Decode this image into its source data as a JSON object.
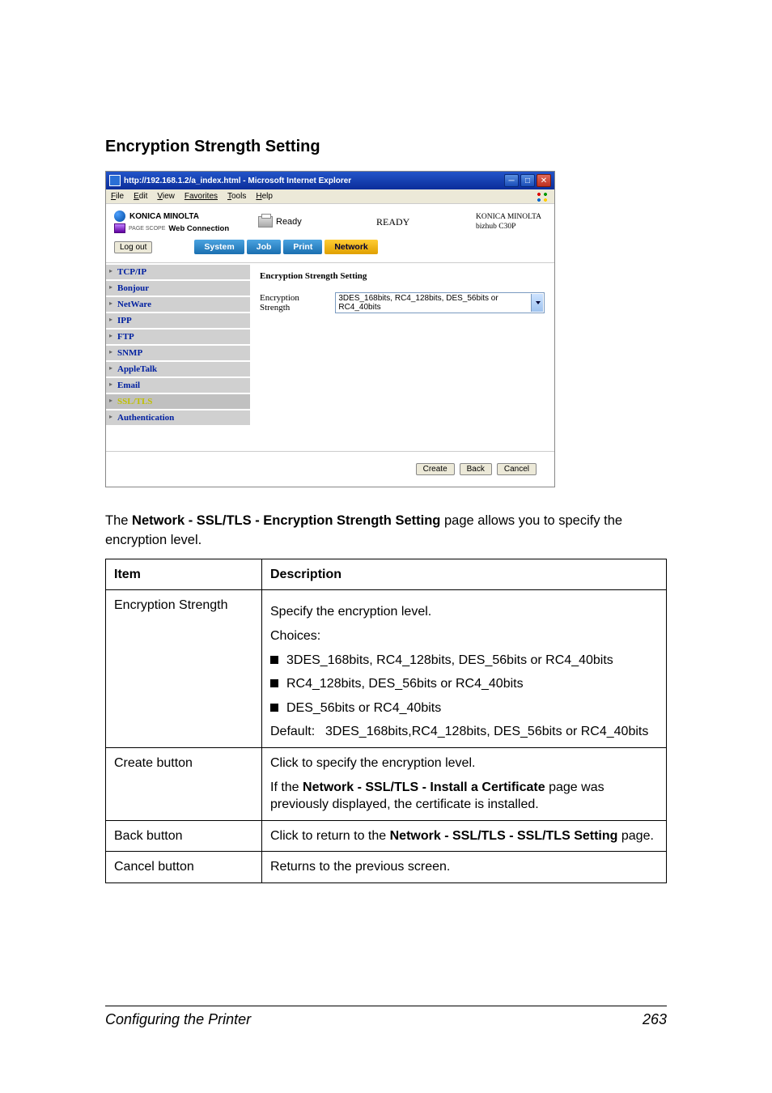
{
  "heading": "Encryption Strength Setting",
  "screenshot": {
    "window_title": "http://192.168.1.2/a_index.html - Microsoft Internet Explorer",
    "menu": [
      "File",
      "Edit",
      "View",
      "Favorites",
      "Tools",
      "Help"
    ],
    "brand": "KONICA MINOLTA",
    "pagescope_label": "PAGE SCOPE",
    "pagescope_text": "Web Connection",
    "ready_small": "Ready",
    "ready_big": "READY",
    "device_line1": "KONICA MINOLTA",
    "device_line2": "bizhub C30P",
    "logout": "Log out",
    "tabs": [
      {
        "label": "System",
        "active": false
      },
      {
        "label": "Job",
        "active": false
      },
      {
        "label": "Print",
        "active": false
      },
      {
        "label": "Network",
        "active": true
      }
    ],
    "sidebar": [
      {
        "label": "TCP/IP",
        "active": false
      },
      {
        "label": "Bonjour",
        "active": false
      },
      {
        "label": "NetWare",
        "active": false
      },
      {
        "label": "IPP",
        "active": false
      },
      {
        "label": "FTP",
        "active": false
      },
      {
        "label": "SNMP",
        "active": false
      },
      {
        "label": "AppleTalk",
        "active": false
      },
      {
        "label": "Email",
        "active": false
      },
      {
        "label": "SSL/TLS",
        "active": true
      },
      {
        "label": "Authentication",
        "active": false
      }
    ],
    "panel_title": "Encryption Strength Setting",
    "field_label": "Encryption Strength",
    "select_value": "3DES_168bits, RC4_128bits, DES_56bits or RC4_40bits",
    "footer_buttons": [
      "Create",
      "Back",
      "Cancel"
    ]
  },
  "intro_para_pre": "The ",
  "intro_para_strong": "Network - SSL/TLS - Encryption Strength Setting",
  "intro_para_post": " page allows you to specify the encryption level.",
  "table": {
    "headers": [
      "Item",
      "Description"
    ],
    "rows": [
      {
        "item": "Encryption Strength",
        "desc_intro": "Specify the encryption level.",
        "desc_choices_label": "Choices:",
        "choices": [
          "3DES_168bits, RC4_128bits, DES_56bits or RC4_40bits",
          "RC4_128bits, DES_56bits or RC4_40bits",
          "DES_56bits or RC4_40bits"
        ],
        "default_label": "Default:",
        "default_value": "3DES_168bits,RC4_128bits, DES_56bits or RC4_40bits"
      },
      {
        "item": "Create button",
        "desc_line1": "Click to specify the encryption level.",
        "desc_line2_pre": "If the ",
        "desc_line2_strong": "Network - SSL/TLS - Install a Certificate",
        "desc_line2_post": " page was previously displayed, the certificate is installed."
      },
      {
        "item": "Back button",
        "desc_pre": "Click to return to the ",
        "desc_strong": "Network - SSL/TLS - SSL/TLS Setting",
        "desc_post": " page."
      },
      {
        "item": "Cancel button",
        "desc": "Returns to the previous screen."
      }
    ]
  },
  "footer_left": "Configuring the Printer",
  "footer_right": "263"
}
